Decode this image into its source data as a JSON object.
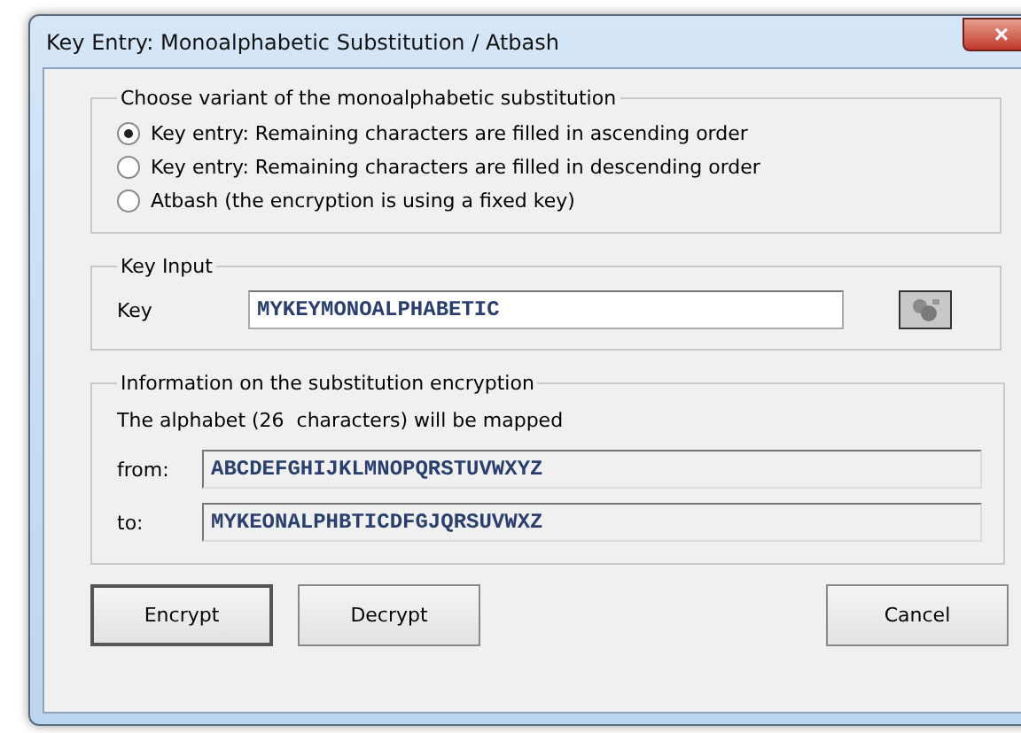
{
  "window": {
    "title": "Key Entry: Monoalphabetic Substitution / Atbash",
    "close": "×"
  },
  "variant_group": {
    "title": "Choose variant of the monoalphabetic substitution",
    "options": [
      {
        "label": "Key entry: Remaining characters are filled in ascending order",
        "selected": true
      },
      {
        "label": "Key entry: Remaining characters are filled in descending order",
        "selected": false
      },
      {
        "label": "Atbash (the encryption is using a fixed key)",
        "selected": false
      }
    ]
  },
  "key_group": {
    "title": "Key Input",
    "label": "Key",
    "value": "MYKEYMONOALPHABETIC"
  },
  "info_group": {
    "title": "Information on the substitution encryption",
    "note": "The alphabet (26  characters) will be mapped",
    "rows": [
      {
        "label": "from:",
        "value": "ABCDEFGHIJKLMNOPQRSTUVWXYZ"
      },
      {
        "label": "to:",
        "value": "MYKEONALPHBTICDFGJQRSUVWXZ"
      }
    ]
  },
  "buttons": [
    "Encrypt",
    "Decrypt",
    "Cancel"
  ]
}
